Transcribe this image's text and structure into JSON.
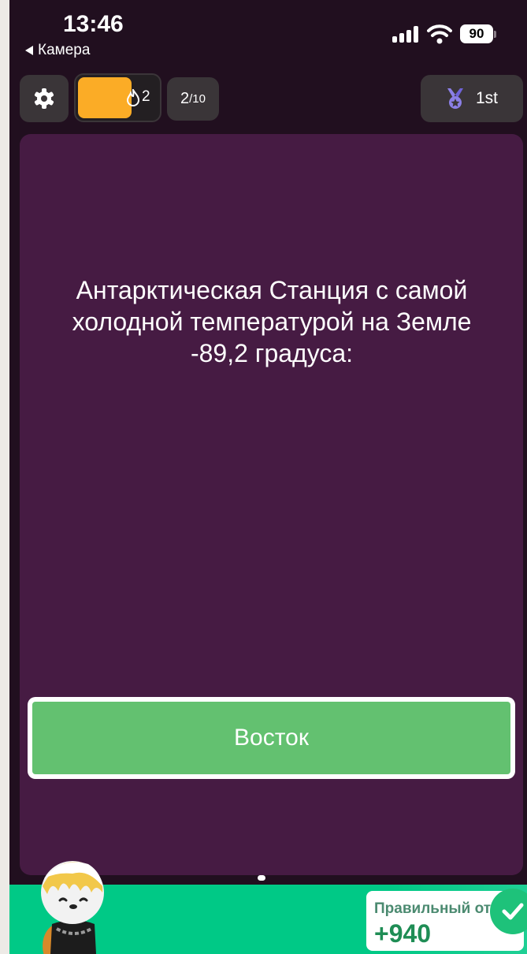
{
  "status_bar": {
    "time": "13:46",
    "back_label": "Камера",
    "battery": "90"
  },
  "top_bar": {
    "settings_icon": "gear-icon",
    "streak_count": "2",
    "streak_level": 0.62,
    "progress_current": "2",
    "progress_total": "10",
    "rank_icon": "medal-icon",
    "rank": "1st"
  },
  "question": {
    "text": "Антарктическая Станция с самой холодной температурой на Земле -89,2 градуса:"
  },
  "answer": {
    "label": "Восток"
  },
  "result": {
    "label": "Правильный от",
    "points": "+940",
    "icon": "checkmark-icon"
  },
  "colors": {
    "background": "#210f1f",
    "card": "#461b43",
    "answer_correct": "#63c170",
    "streak_fill": "#fbac26",
    "banner": "#00c986"
  }
}
